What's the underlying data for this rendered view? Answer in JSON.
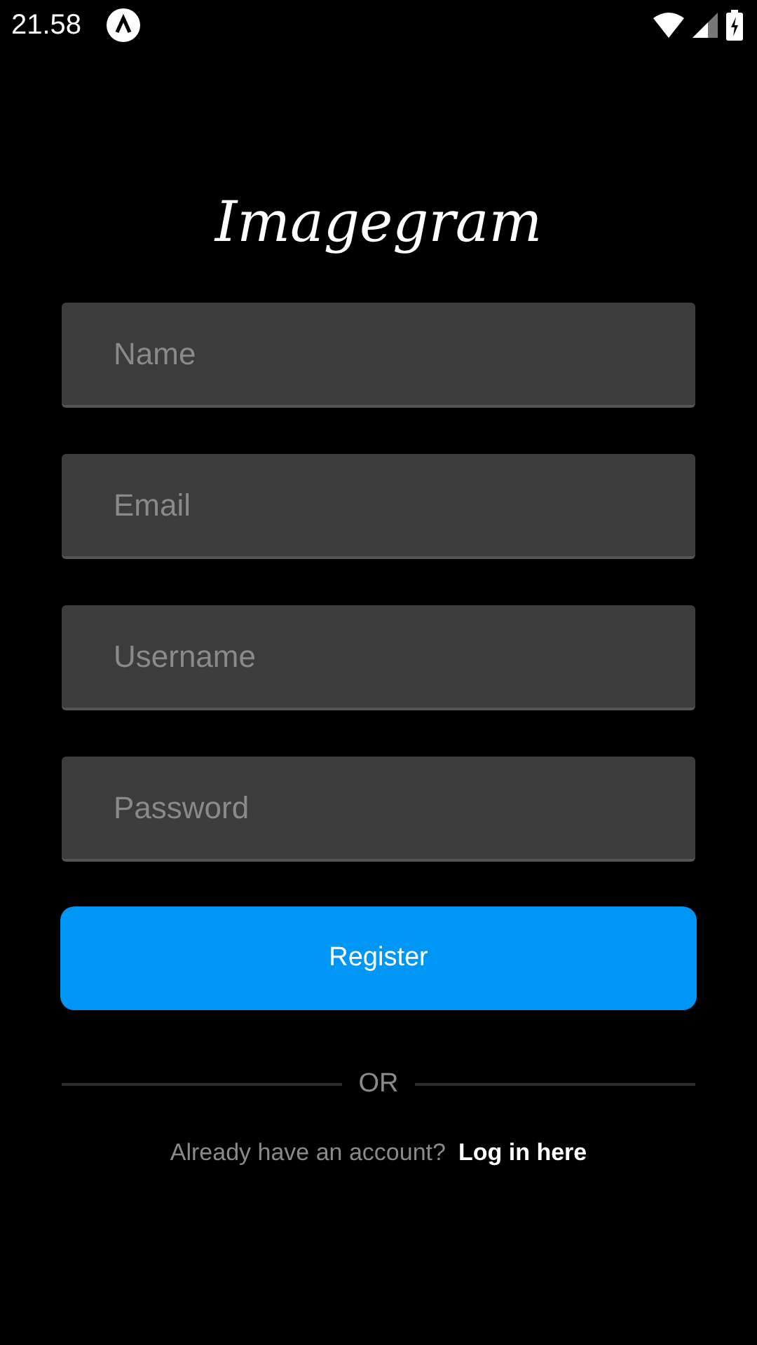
{
  "status_bar": {
    "time": "21.58"
  },
  "logo": "Imagegram",
  "fields": [
    {
      "placeholder": "Name"
    },
    {
      "placeholder": "Email"
    },
    {
      "placeholder": "Username"
    },
    {
      "placeholder": "Password"
    }
  ],
  "register_button": "Register",
  "divider": "OR",
  "footer": {
    "prompt": "Already have an account?",
    "link": "Log in here"
  }
}
